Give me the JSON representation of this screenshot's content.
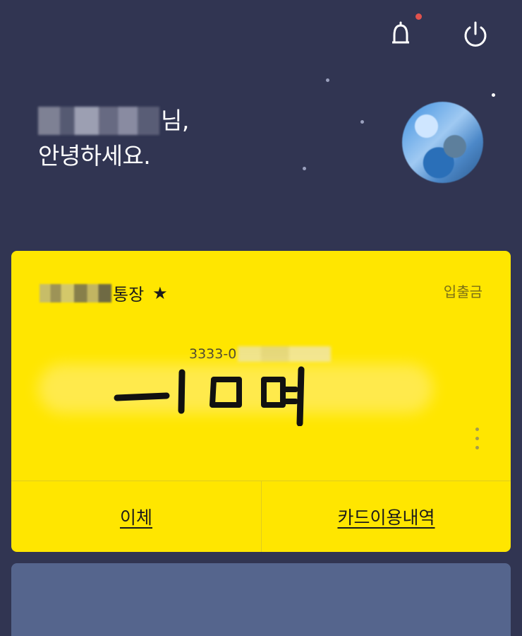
{
  "topbar": {
    "notifications_icon": "bell-icon",
    "logout_icon": "power-icon",
    "has_new_notification": true,
    "notification_color": "#e0524d"
  },
  "greeting": {
    "name_suffix": "님,",
    "line2": "안녕하세요."
  },
  "account_card": {
    "name_suffix": "통장",
    "favorite_icon": "★",
    "inout_label": "입출금",
    "account_number_prefix": "3333-0",
    "balance_handwritten": "-10억",
    "transfer_label": "이체",
    "card_history_label": "카드이용내역",
    "background_color": "#ffe600"
  },
  "colors": {
    "background": "#313552",
    "next_card": "#55658d"
  }
}
